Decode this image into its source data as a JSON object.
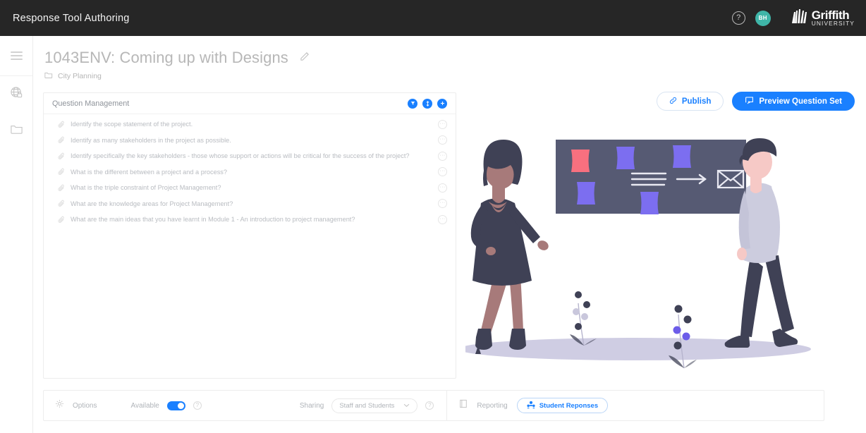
{
  "topbar": {
    "title": "Response Tool Authoring",
    "help_icon": "question-circle-icon",
    "avatar_initials": "BH",
    "brand_name": "Griffith",
    "brand_sub": "UNIVERSITY"
  },
  "rail": {
    "menu_icon": "hamburger-menu-icon",
    "items": [
      {
        "icon": "globe-lock-icon",
        "name": "globe"
      },
      {
        "icon": "folder-icon",
        "name": "folder"
      }
    ]
  },
  "header": {
    "title": "1043ENV: Coming up with Designs",
    "edit_icon": "edit-pencil-icon",
    "breadcrumb_icon": "folder-icon",
    "breadcrumb": "City Planning",
    "publish_label": "Publish",
    "publish_icon": "link-icon",
    "preview_label": "Preview Question Set",
    "preview_icon": "preview-window-icon"
  },
  "question_panel": {
    "title": "Question Management",
    "tools": [
      {
        "name": "filter-button",
        "icon": "filter-funnel-icon"
      },
      {
        "name": "sort-button",
        "icon": "sort-updown-icon"
      },
      {
        "name": "add-question-button",
        "icon": "plus-icon"
      }
    ],
    "row_icon": "paperclip-icon",
    "row_menu_label": "···",
    "questions": [
      "Identify the scope statement of the project.",
      "Identify as many stakeholders in the project as possible.",
      "Identify specifically the key stakeholders - those whose support or actions will be critical for the success of the project?",
      "What is the different between a project and a process?",
      "What is the triple constraint of Project Management?",
      "What are the knowledge areas for Project Management?",
      "What are the main ideas that you have learnt in Module 1 - An introduction to project management?"
    ]
  },
  "bottombar": {
    "options_icon": "gear-icon",
    "options_label": "Options",
    "available_label": "Available",
    "available_on": true,
    "available_help_icon": "question-circle-icon",
    "sharing_label": "Sharing",
    "sharing_value": "Staff and Students",
    "sharing_caret_icon": "chevron-down-icon",
    "sharing_help_icon": "question-circle-icon",
    "reporting_icon": "report-icon",
    "reporting_label": "Reporting",
    "student_responses_label": "Student Reponses",
    "student_responses_icon": "people-group-icon"
  },
  "illustration": {
    "name": "brainstorming-illustration",
    "board_color": "#565a73",
    "note_pink": "#f8707f",
    "note_purple": "#7c6ef0",
    "ground_color": "#cfcde3"
  },
  "colors": {
    "accent": "#1a80ff",
    "topbar_bg": "#262626",
    "avatar_bg": "#3fb5a8",
    "muted_text": "#b9bcc1"
  }
}
